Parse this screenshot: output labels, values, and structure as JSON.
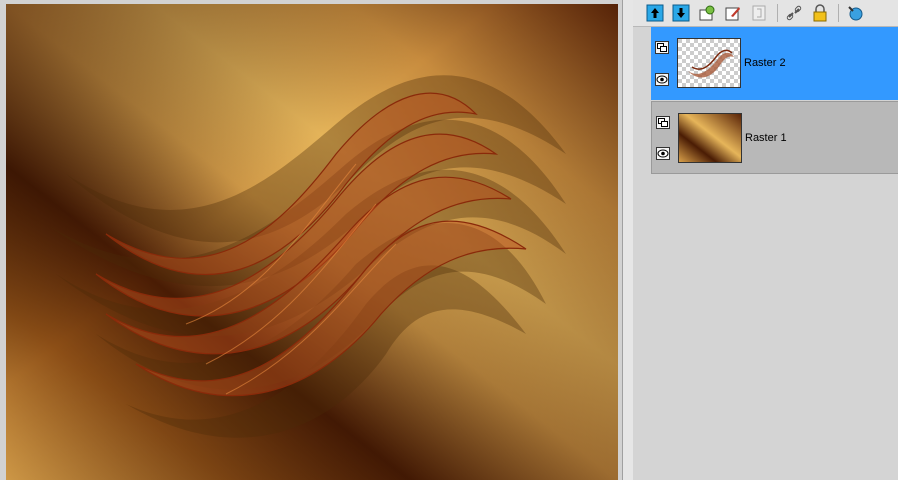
{
  "canvas": {
    "description": "abstract-wave-artwork"
  },
  "layers_panel": {
    "toolbar": [
      {
        "name": "move-layer-up-icon"
      },
      {
        "name": "move-layer-down-icon"
      },
      {
        "name": "layer-properties-icon"
      },
      {
        "name": "edit-selection-icon"
      },
      {
        "name": "merge-icon"
      },
      {
        "name": "link-icon"
      },
      {
        "name": "lock-icon"
      },
      {
        "name": "help-icon"
      }
    ],
    "layers": [
      {
        "name": "Raster 2",
        "selected": true,
        "visible": true
      },
      {
        "name": "Raster 1",
        "selected": false,
        "visible": true
      }
    ]
  },
  "colors": {
    "selection": "#3399ff",
    "gold": "#e1aa4c",
    "dark_brown": "#4a1c04",
    "rust": "#b4401a"
  }
}
